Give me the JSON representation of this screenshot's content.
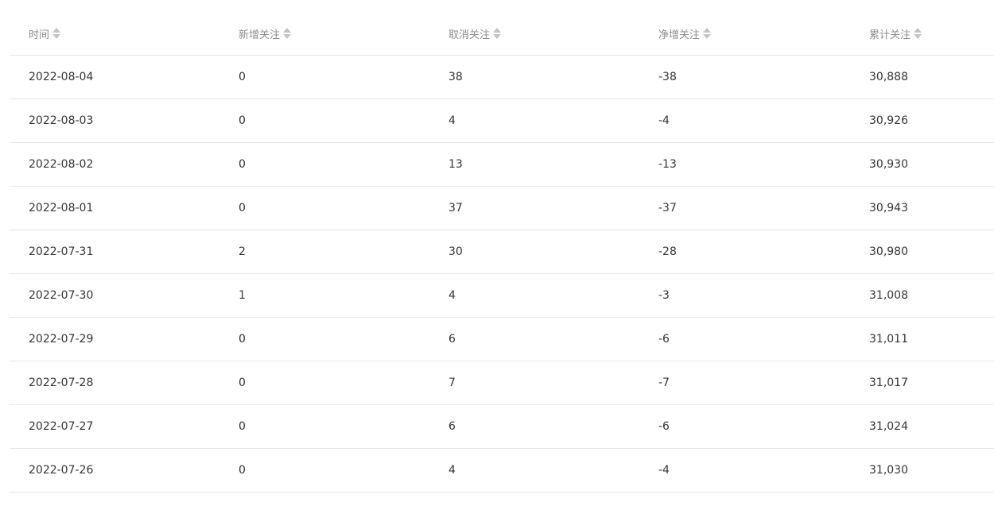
{
  "table": {
    "headers": [
      {
        "label": "时间",
        "sort_icon": "sort-icon"
      },
      {
        "label": "新增关注",
        "sort_icon": "sort-icon"
      },
      {
        "label": "取消关注",
        "sort_icon": "sort-icon"
      },
      {
        "label": "净增关注",
        "sort_icon": "sort-icon"
      },
      {
        "label": "累计关注",
        "sort_icon": "sort-icon"
      }
    ],
    "rows": [
      [
        "2022-08-04",
        "0",
        "38",
        "-38",
        "30,888"
      ],
      [
        "2022-08-03",
        "0",
        "4",
        "-4",
        "30,926"
      ],
      [
        "2022-08-02",
        "0",
        "13",
        "-13",
        "30,930"
      ],
      [
        "2022-08-01",
        "0",
        "37",
        "-37",
        "30,943"
      ],
      [
        "2022-07-31",
        "2",
        "30",
        "-28",
        "30,980"
      ],
      [
        "2022-07-30",
        "1",
        "4",
        "-3",
        "31,008"
      ],
      [
        "2022-07-29",
        "0",
        "6",
        "-6",
        "31,011"
      ],
      [
        "2022-07-28",
        "0",
        "7",
        "-7",
        "31,017"
      ],
      [
        "2022-07-27",
        "0",
        "6",
        "-6",
        "31,024"
      ],
      [
        "2022-07-26",
        "0",
        "4",
        "-4",
        "31,030"
      ]
    ]
  },
  "colors": {
    "header_text": "#8d8d8d",
    "body_text": "#353535",
    "row_divider": "#e7e7eb",
    "sort_icon": "#c4c4c4"
  }
}
